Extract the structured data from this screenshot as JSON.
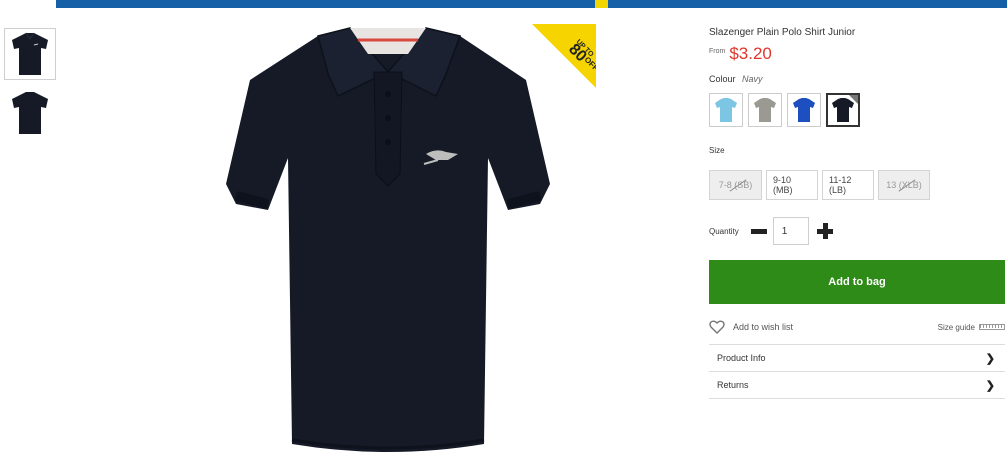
{
  "product": {
    "title": "Slazenger Plain Polo Shirt Junior",
    "price_prefix": "From",
    "price": "$3.20",
    "badge_text": "UP TO 80% OFF"
  },
  "colour": {
    "label": "Colour",
    "selected": "Navy",
    "options": [
      {
        "name": "Sky Blue",
        "color": "#7cc6e3"
      },
      {
        "name": "Grey",
        "color": "#9a9a92"
      },
      {
        "name": "Royal Blue",
        "color": "#1e4fc0"
      },
      {
        "name": "Navy",
        "color": "#151a26"
      }
    ]
  },
  "size": {
    "label": "Size",
    "options": [
      {
        "label": "7-8 (SB)",
        "available": false
      },
      {
        "label": "9-10 (MB)",
        "available": true
      },
      {
        "label": "11-12 (LB)",
        "available": true
      },
      {
        "label": "13 (XLB)",
        "available": false
      }
    ]
  },
  "quantity": {
    "label": "Quantity",
    "value": "1"
  },
  "actions": {
    "add_to_bag": "Add to bag",
    "wish_list": "Add to wish list",
    "size_guide": "Size guide"
  },
  "accordion": [
    {
      "label": "Product Info"
    },
    {
      "label": "Returns"
    }
  ],
  "colors": {
    "accent_green": "#2e8b17",
    "price_red": "#e0362c",
    "banner_blue": "#1660a8",
    "badge_yellow": "#f5d400"
  }
}
